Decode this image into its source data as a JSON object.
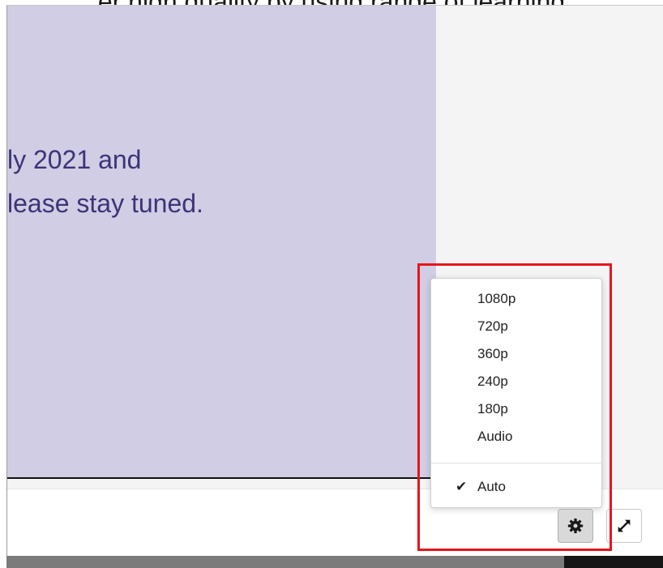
{
  "caption": {
    "text": "er high quality by using range of learning"
  },
  "slide": {
    "line1": "ly 2021 and",
    "line2": "lease stay tuned."
  },
  "quality_menu": {
    "items": [
      {
        "label": "1080p",
        "selected": false
      },
      {
        "label": "720p",
        "selected": false
      },
      {
        "label": "360p",
        "selected": false
      },
      {
        "label": "240p",
        "selected": false
      },
      {
        "label": "180p",
        "selected": false
      },
      {
        "label": "Audio",
        "selected": false
      }
    ],
    "auto_item": {
      "label": "Auto",
      "selected": true,
      "check_mark": "✔"
    }
  },
  "controls": {
    "settings_icon": "gear-icon",
    "fullscreen_icon": "expand-arrows-icon"
  },
  "colors": {
    "slide_background": "#d0cde4",
    "slide_text": "#3c3478",
    "highlight": "#e8141a"
  }
}
